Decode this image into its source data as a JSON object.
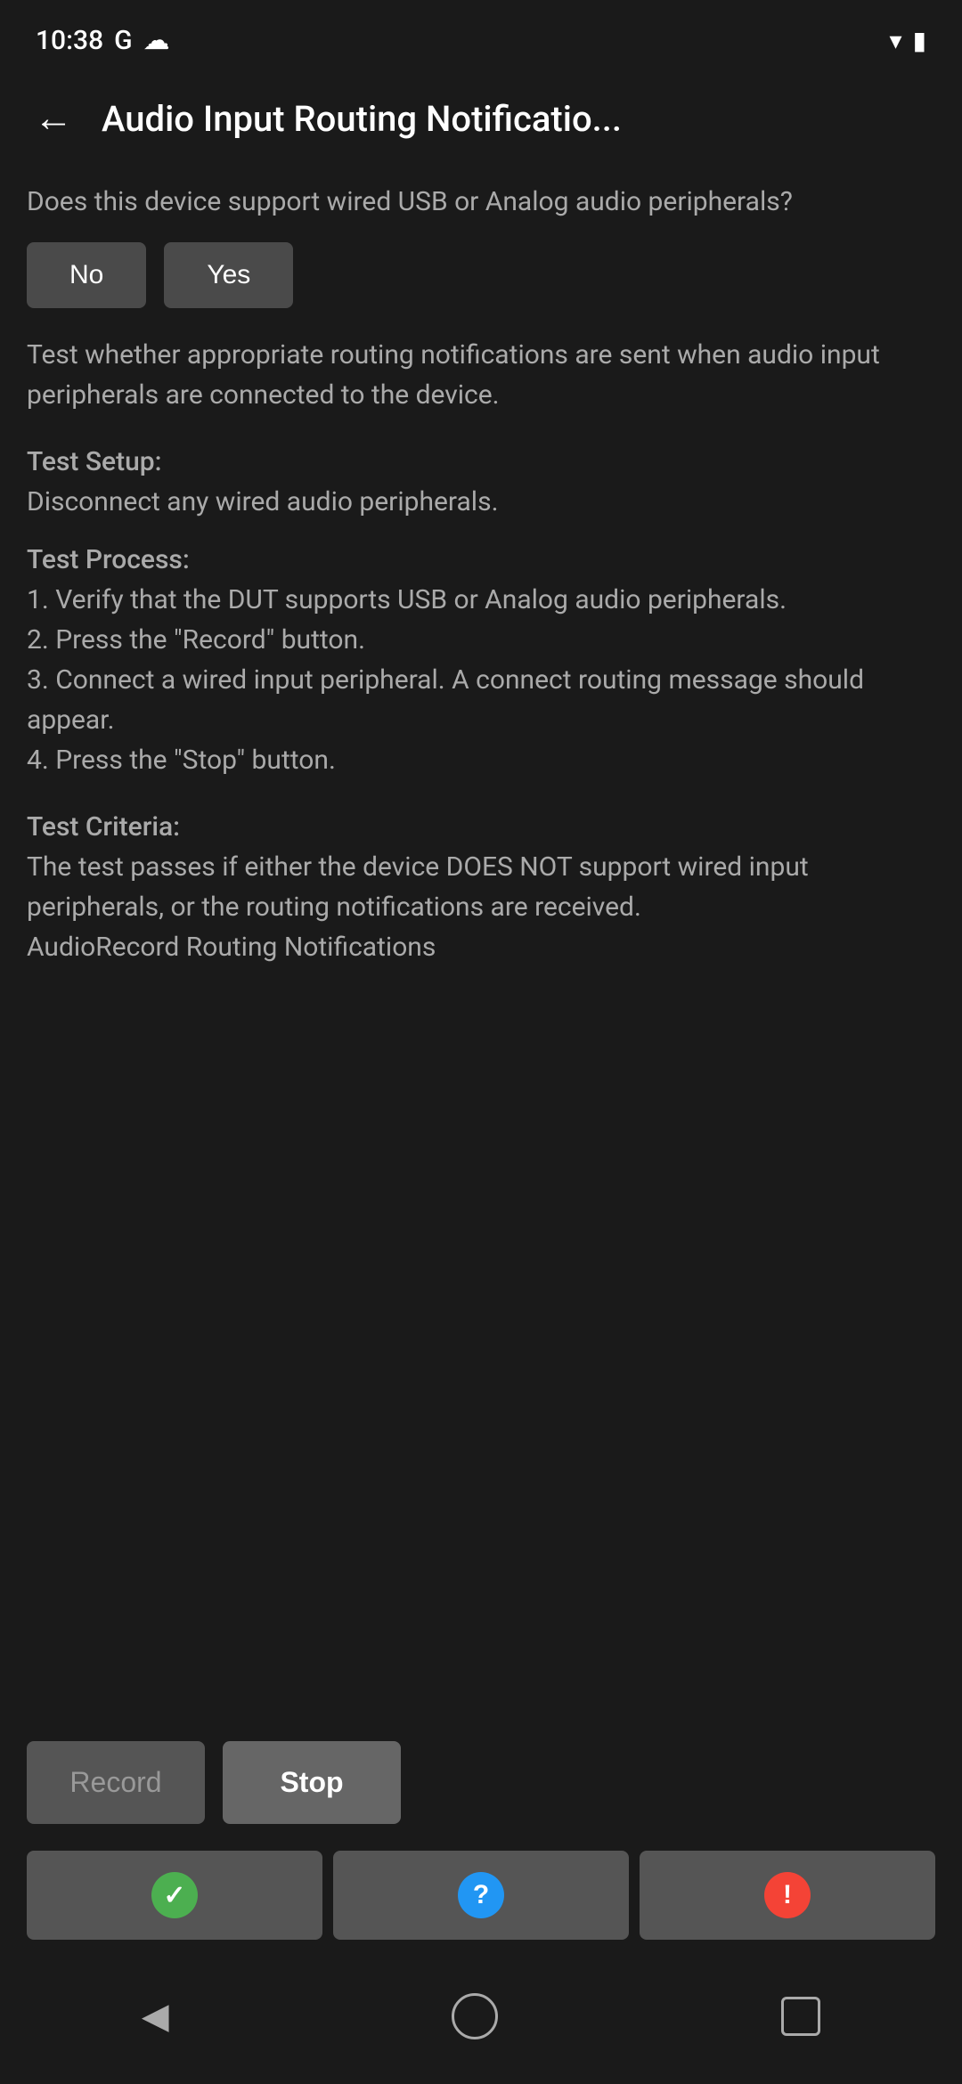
{
  "statusBar": {
    "time": "10:38",
    "googleIcon": "G",
    "cloudIcon": "☁"
  },
  "header": {
    "backLabel": "←",
    "title": "Audio Input Routing Notificatio..."
  },
  "content": {
    "questionText": "Does this device support wired USB or Analog audio peripherals?",
    "noButton": "No",
    "yesButton": "Yes",
    "descriptionText": "Test whether appropriate routing notifications are sent when audio input peripherals are connected to the device.",
    "testSetupLabel": "Test Setup:",
    "testSetupBody": "Disconnect any wired audio peripherals.",
    "testProcessLabel": "Test Process:",
    "testProcessBody": "1. Verify that the DUT supports USB or Analog audio peripherals.\n2. Press the \"Record\" button.\n3. Connect a wired input peripheral. A connect routing message should appear.\n4. Press the \"Stop\" button.",
    "testCriteriaLabel": "Test Criteria:",
    "testCriteriaBody": "The test passes if either the device DOES NOT support wired input peripherals, or the routing notifications are received.",
    "testCriteriaTag": "AudioRecord Routing Notifications"
  },
  "actionButtons": {
    "recordLabel": "Record",
    "stopLabel": "Stop"
  },
  "resultButtons": {
    "passIcon": "✓",
    "questionIcon": "?",
    "failIcon": "!"
  },
  "navBar": {
    "backLabel": "◀"
  }
}
